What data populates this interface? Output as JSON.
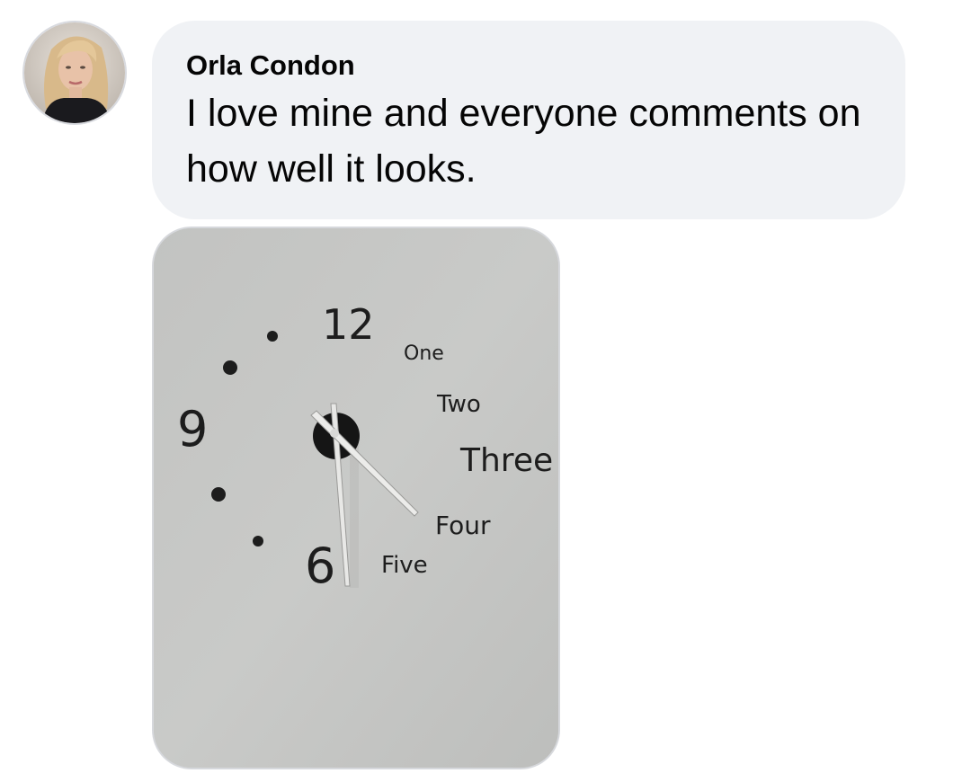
{
  "comment": {
    "author": "Orla Condon",
    "text": "I love mine and everyone comments on how well it looks."
  },
  "avatar": {
    "icon": "user-avatar-photo"
  },
  "photo": {
    "icon": "wall-clock-photo",
    "clock_numerals": {
      "twelve": "12",
      "one": "One",
      "two": "Two",
      "three": "Three",
      "four": "Four",
      "five": "Five",
      "six": "6",
      "nine": "9"
    }
  },
  "colors": {
    "bubble_bg": "#f0f2f5",
    "text": "#050505",
    "wall": "#c3c4c2"
  }
}
